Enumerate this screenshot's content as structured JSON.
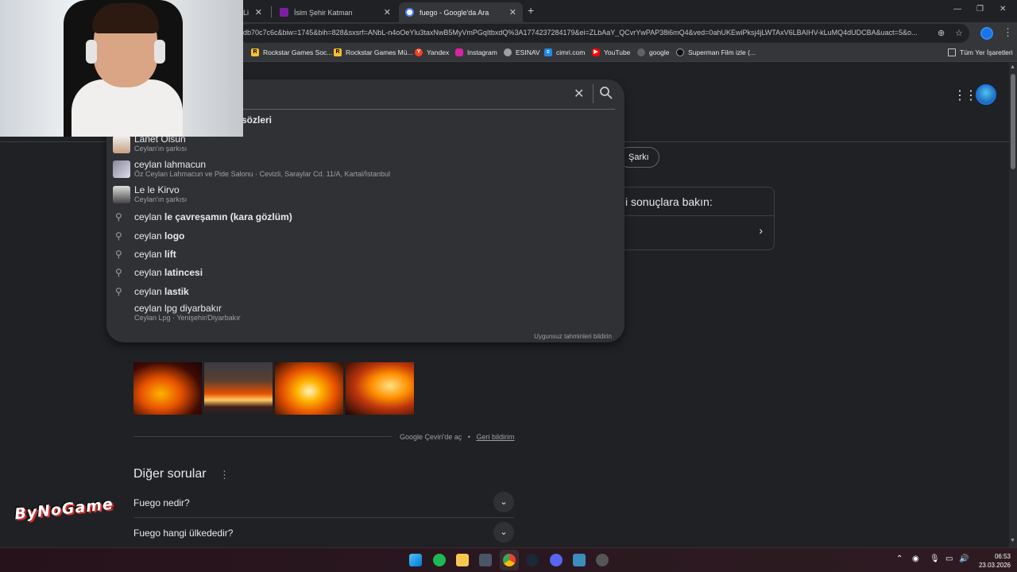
{
  "browser": {
    "tabs": [
      {
        "title": "Li"
      },
      {
        "title": "İsim Şehir Katman"
      },
      {
        "title": "fuego - Google'da Ara"
      }
    ],
    "new_tab_symbol": "+",
    "url": "db70c7c6c&biw=1745&bih=828&sxsrf=ANbL-n4oOeYlu3taxNwB5MyVmPGqItbxdQ%3A1774237284179&ei=ZLbAaY_QCvrYwPAP38i6mQ4&ved=0ahUKEwiPksj4jLWTAxV6LBAIHV-kLuMQ4dUDCBA&uact=5&o...",
    "bookmarks": [
      {
        "label": "Rockstar Games Soc..."
      },
      {
        "label": "Rockstar Games Mü..."
      },
      {
        "label": "Yandex"
      },
      {
        "label": "Instagram"
      },
      {
        "label": "ESINAV"
      },
      {
        "label": "cimri.com"
      },
      {
        "label": "YouTube"
      },
      {
        "label": "google"
      },
      {
        "label": "Superman Film izle (..."
      }
    ],
    "all_bookmarks": "Tüm Yer İşaretleri"
  },
  "search": {
    "partial_top": "sözleri",
    "suggestions": [
      {
        "prefix": "Lanet Olsun",
        "bold": "",
        "sub": "Ceylan'ın şarkısı",
        "kind": "entity"
      },
      {
        "prefix": "ceylan lahmacun",
        "bold": "",
        "sub": "Öz Ceylan Lahmacun ve Pide Salonu · Cevizli, Saraylar Cd. 11/A, Kartal/İstanbul",
        "kind": "entity"
      },
      {
        "prefix": "Le le Kirvo",
        "bold": "",
        "sub": "Ceylan'ın şarkısı",
        "kind": "entity"
      },
      {
        "prefix": "ceylan ",
        "bold": "le çavreşamın (kara gözlüm)",
        "sub": "",
        "kind": "query"
      },
      {
        "prefix": "ceylan ",
        "bold": "logo",
        "sub": "",
        "kind": "query"
      },
      {
        "prefix": "ceylan ",
        "bold": "lift",
        "sub": "",
        "kind": "query"
      },
      {
        "prefix": "ceylan ",
        "bold": "latincesi",
        "sub": "",
        "kind": "query"
      },
      {
        "prefix": "ceylan ",
        "bold": "lastik",
        "sub": "",
        "kind": "query"
      },
      {
        "prefix": "ceylan lpg diyarbakır",
        "bold": "",
        "sub": "Ceylan Lpg · Yenişehir/Diyarbakır",
        "kind": "place"
      }
    ],
    "report": "Uygunsuz tahminleri bildirin"
  },
  "results": {
    "chip": "Şarkı",
    "side_title": "i sonuçlara bakın:",
    "translate": "Google Çeviri'de aç",
    "dot": "•",
    "feedback": "Geri bildirim",
    "paa_title": "Diğer sorular",
    "questions": [
      "Fuego nedir?",
      "Fuego hangi ülkededir?"
    ]
  },
  "watermark": "ByNoGame",
  "clock": {
    "time": "06:53",
    "date": "23.03.2026"
  },
  "colors": {
    "bg": "#202124",
    "panel": "#303134",
    "accent": "#1a73e8"
  }
}
